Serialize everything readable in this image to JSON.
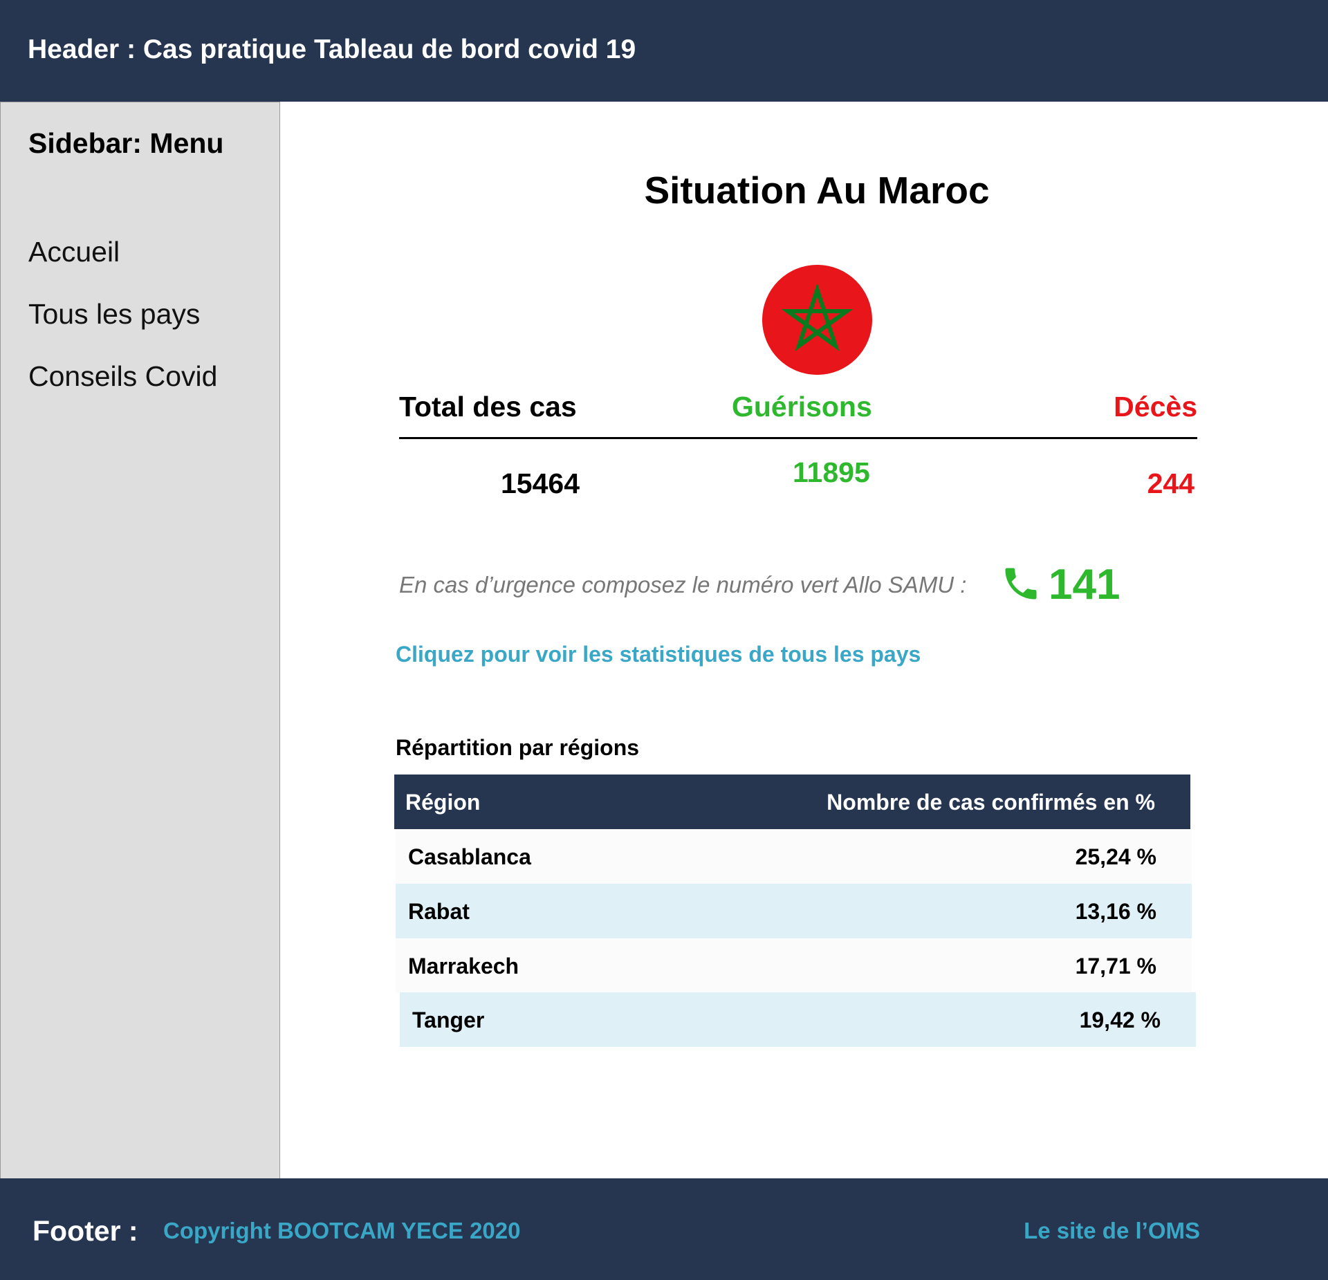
{
  "header": {
    "title": "Header : Cas pratique Tableau de bord covid 19"
  },
  "sidebar": {
    "title": "Sidebar: Menu",
    "items": [
      {
        "label": "Accueil"
      },
      {
        "label": "Tous les pays"
      },
      {
        "label": "Conseils Covid"
      }
    ]
  },
  "main": {
    "title": "Situation Au Maroc",
    "flag_icon": "morocco-flag-icon",
    "stats": {
      "total_label": "Total des cas",
      "total_value": "15464",
      "recovered_label": "Guérisons",
      "recovered_value": "11895",
      "deaths_label": "Décès",
      "deaths_value": "244"
    },
    "emergency": {
      "text": "En cas d’urgence composez le numéro vert Allo SAMU :",
      "icon": "phone-icon",
      "number": "141"
    },
    "link_all_countries": "Cliquez pour voir les statistiques de tous les pays",
    "regions": {
      "title": "Répartition par régions",
      "headers": [
        "Région",
        "Nombre de cas confirmés en %"
      ],
      "rows": [
        {
          "region": "Casablanca",
          "percent": "25,24 %"
        },
        {
          "region": "Rabat",
          "percent": "13,16 %"
        },
        {
          "region": "Marrakech",
          "percent": "17,71 %"
        },
        {
          "region": "Tanger",
          "percent": "19,42 %"
        }
      ]
    }
  },
  "footer": {
    "label": "Footer :",
    "copyright": "Copyright BOOTCAM YECE 2020",
    "oms_link": "Le site de l’OMS"
  },
  "colors": {
    "navy": "#263650",
    "sidebar_bg": "#dedede",
    "green": "#2eb82e",
    "red": "#e8161b",
    "link_blue": "#3aa7c6",
    "row_blue": "#dff0f6"
  }
}
